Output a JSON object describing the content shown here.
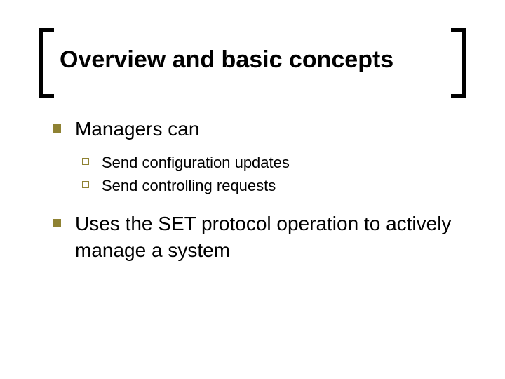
{
  "title": "Overview and basic concepts",
  "bullets": {
    "item1": "Managers can",
    "item1_sub1": "Send configuration updates",
    "item1_sub2": "Send controlling requests",
    "item2": "Uses the SET protocol operation to actively manage a system"
  }
}
